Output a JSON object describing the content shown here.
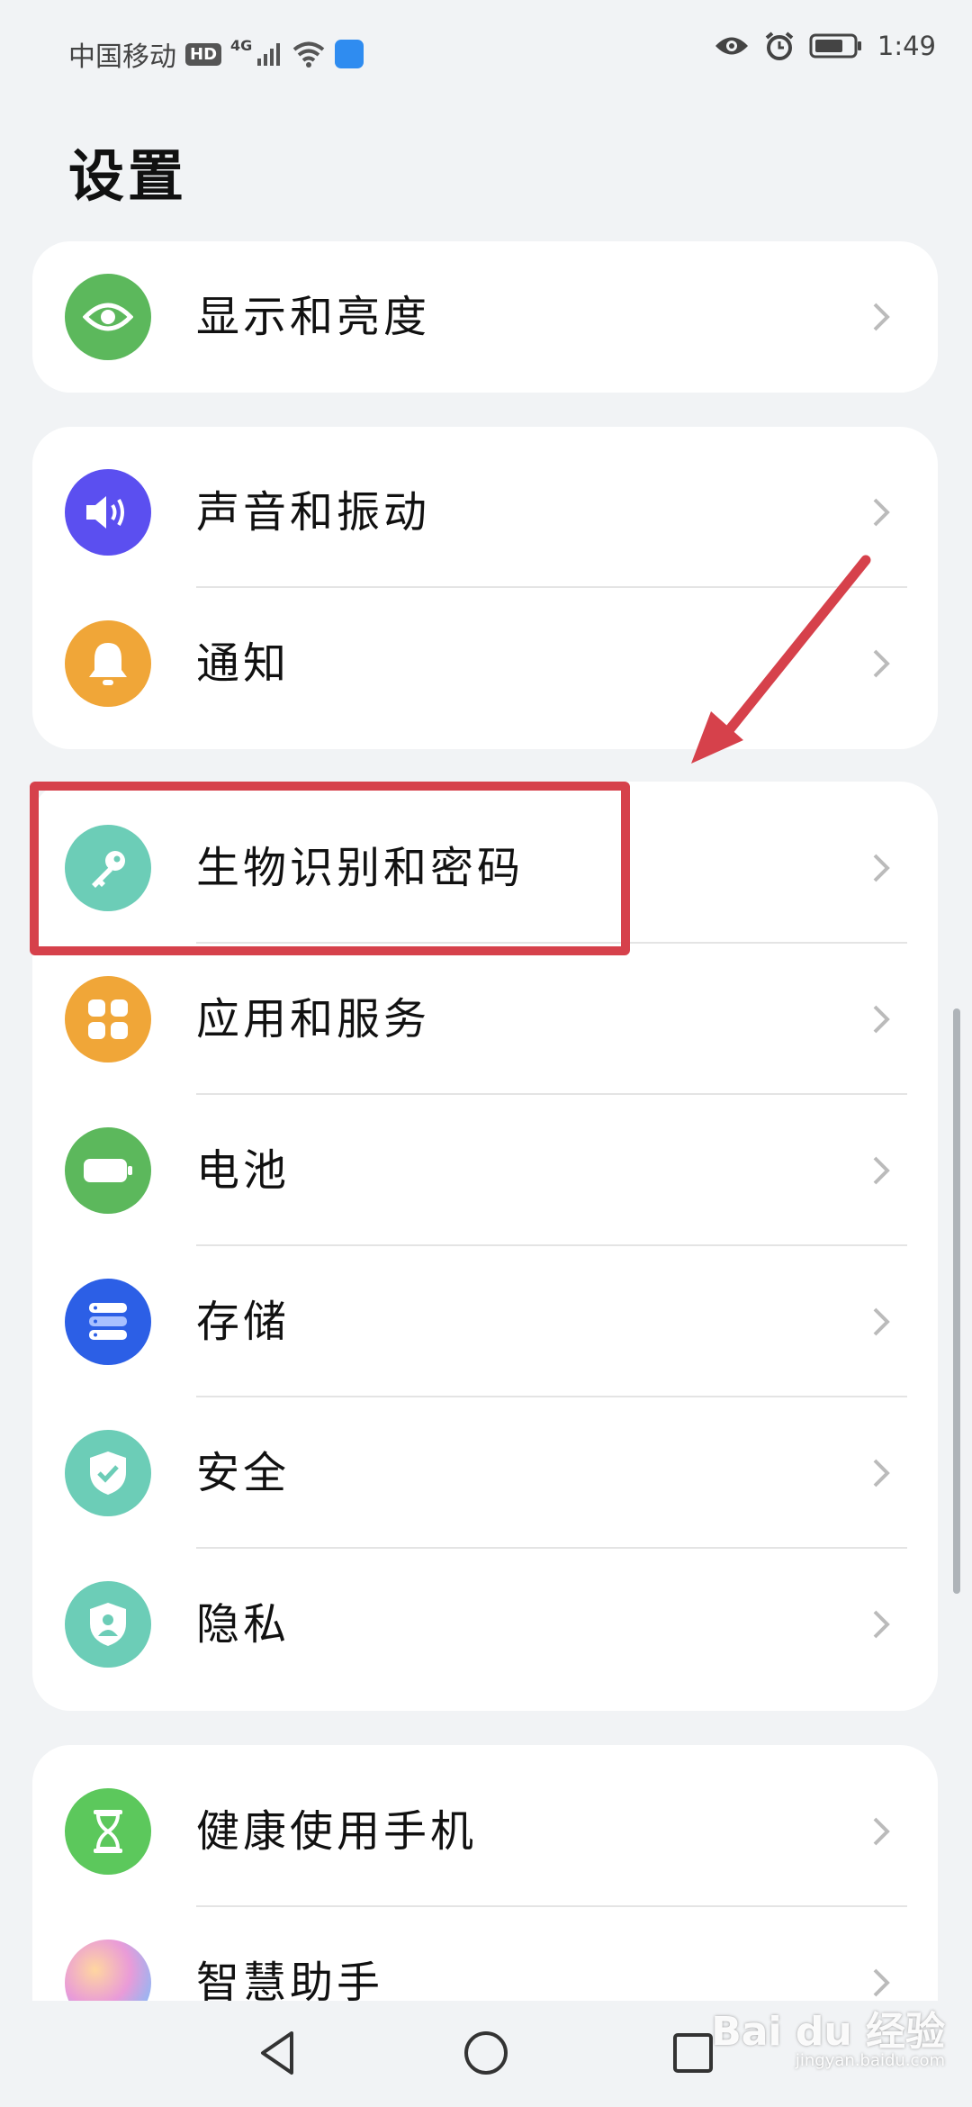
{
  "status_bar": {
    "carrier": "中国移动",
    "hd_badge": "HD",
    "network": "4G",
    "time": "1:49"
  },
  "page_title": "设置",
  "groups": [
    {
      "items": [
        {
          "label": "显示和亮度",
          "icon": "eye-icon",
          "color": "#5cb85c"
        }
      ]
    },
    {
      "items": [
        {
          "label": "声音和振动",
          "icon": "speaker-icon",
          "color": "#5b4ff0"
        },
        {
          "label": "通知",
          "icon": "bell-icon",
          "color": "#f0a638"
        }
      ]
    },
    {
      "items": [
        {
          "label": "生物识别和密码",
          "icon": "key-icon",
          "color": "#6ccdb7"
        },
        {
          "label": "应用和服务",
          "icon": "apps-icon",
          "color": "#f0a638"
        },
        {
          "label": "电池",
          "icon": "battery-icon",
          "color": "#5cb85c"
        },
        {
          "label": "存储",
          "icon": "storage-icon",
          "color": "#2c5fe6"
        },
        {
          "label": "安全",
          "icon": "shield-check-icon",
          "color": "#6ccdb7"
        },
        {
          "label": "隐私",
          "icon": "privacy-shield-icon",
          "color": "#6ccdb7"
        }
      ]
    },
    {
      "items": [
        {
          "label": "健康使用手机",
          "icon": "hourglass-icon",
          "color": "#5cc85c"
        },
        {
          "label": "智慧助手",
          "icon": "assistant-orb-icon",
          "color": "#c98ff0"
        }
      ]
    }
  ],
  "watermark": {
    "brand": "Bai du 经验",
    "url": "jingyan.baidu.com"
  }
}
